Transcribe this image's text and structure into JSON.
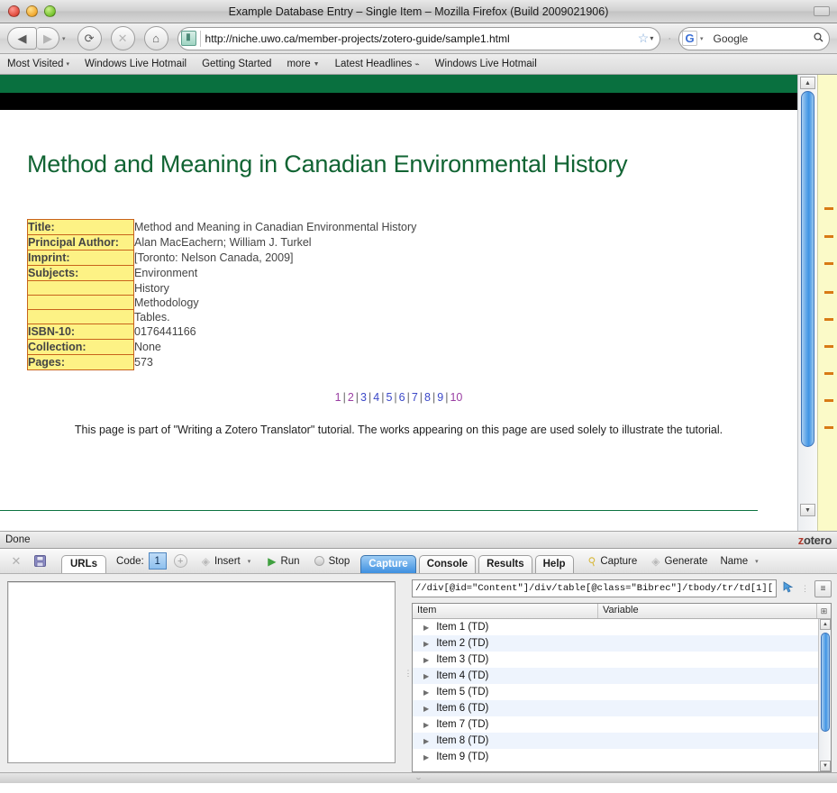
{
  "window": {
    "title": "Example Database Entry – Single Item – Mozilla Firefox (Build 2009021906)"
  },
  "nav": {
    "back_icon": "◀",
    "forward_icon": "▶",
    "history_caret": "▾",
    "reload_icon": "⟳",
    "stop_icon": "✕",
    "home_icon": "⌂",
    "favicon_glyph": "Ⅱ",
    "url": "http://niche.uwo.ca/member-projects/zotero-guide/sample1.html",
    "star_icon": "☆",
    "url_caret": "▾",
    "separator_dot": "·",
    "search_engine_glyph": "G",
    "search_engine_caret": "▾",
    "search_text": "Google",
    "search_placeholder": "Google",
    "search_icon": "🔍"
  },
  "bookmarks": [
    {
      "label": "Most Visited",
      "caret": "▾",
      "feed": ""
    },
    {
      "label": "Windows Live Hotmail",
      "caret": "",
      "feed": ""
    },
    {
      "label": "Getting Started",
      "caret": "",
      "feed": ""
    },
    {
      "label": "more",
      "caret": "▼",
      "feed": ""
    },
    {
      "label": "Latest Headlines",
      "caret": "",
      "feed": "⌁"
    },
    {
      "label": "Windows Live Hotmail",
      "caret": "",
      "feed": ""
    }
  ],
  "page": {
    "heading": "Method and Meaning in Canadian Environmental History",
    "bibrec": [
      {
        "label": "Title:",
        "value": "Method and Meaning in Canadian Environmental History"
      },
      {
        "label": "Principal Author:",
        "value": "Alan MacEachern; William J. Turkel"
      },
      {
        "label": "Imprint:",
        "value": "[Toronto: Nelson Canada, 2009]"
      },
      {
        "label": "Subjects:",
        "value": "Environment"
      },
      {
        "label": "",
        "value": "History"
      },
      {
        "label": "",
        "value": "Methodology"
      },
      {
        "label": "",
        "value": "Tables."
      },
      {
        "label": "ISBN-10:",
        "value": "0176441166"
      },
      {
        "label": "Collection:",
        "value": "None"
      },
      {
        "label": "Pages:",
        "value": "573"
      }
    ],
    "pager": [
      {
        "label": "1",
        "state": "visited"
      },
      {
        "label": "2",
        "state": "visited"
      },
      {
        "label": "3",
        "state": "unvisited"
      },
      {
        "label": "4",
        "state": "unvisited"
      },
      {
        "label": "5",
        "state": "unvisited"
      },
      {
        "label": "6",
        "state": "unvisited"
      },
      {
        "label": "7",
        "state": "unvisited"
      },
      {
        "label": "8",
        "state": "unvisited"
      },
      {
        "label": "9",
        "state": "unvisited"
      },
      {
        "label": "10",
        "state": "visited"
      }
    ],
    "pager_separator": "|",
    "footer_note": "This page is part of \"Writing a Zotero Translator\" tutorial. The works appearing on this page are used solely to illustrate the tutorial.",
    "scroll_up_icon": "▲",
    "scroll_down_icon": "▼"
  },
  "statusbar": {
    "status_text": "Done",
    "brand_z": "z",
    "brand_rest": "otero"
  },
  "devtools": {
    "close_icon": "✕",
    "save_icon": "💾",
    "urls_tab": "URLs",
    "code_label": "Code:",
    "code_value": "1",
    "add_icon": "+",
    "insert_label": "Insert",
    "insert_caret": "▾",
    "run_label": "Run",
    "run_icon": "▶",
    "stop_label": "Stop",
    "tabs": [
      {
        "label": "Capture",
        "active": true
      },
      {
        "label": "Console",
        "active": false
      },
      {
        "label": "Results",
        "active": false
      },
      {
        "label": "Help",
        "active": false
      }
    ],
    "capture_label": "Capture",
    "generate_label": "Generate",
    "name_label": "Name",
    "name_caret": "▾",
    "xpath_value": "//div[@id=\"Content\"]/div/table[@class=\"Bibrec\"]/tbody/tr/td[1][",
    "xpath_placeholder": "XPath expression",
    "xpath_pick_icon": "⬉",
    "xpath_options_icon": "≡",
    "columns": [
      "Item",
      "Variable"
    ],
    "column_picker_icon": "⊞",
    "rows": [
      {
        "item": "Item 1 (TD)",
        "variable": ""
      },
      {
        "item": "Item 2 (TD)",
        "variable": ""
      },
      {
        "item": "Item 3 (TD)",
        "variable": ""
      },
      {
        "item": "Item 4 (TD)",
        "variable": ""
      },
      {
        "item": "Item 5 (TD)",
        "variable": ""
      },
      {
        "item": "Item 6 (TD)",
        "variable": ""
      },
      {
        "item": "Item 7 (TD)",
        "variable": ""
      },
      {
        "item": "Item 8 (TD)",
        "variable": ""
      },
      {
        "item": "Item 9 (TD)",
        "variable": ""
      }
    ],
    "row_expand_icon": "▶",
    "scroll_up_icon": "▲",
    "scroll_down_icon": "▼",
    "code_editor_value": ""
  },
  "colors": {
    "page_heading": "#116433",
    "banner_green": "#09703f",
    "label_bg": "#fdf285",
    "label_border": "#c8631c",
    "link_visited": "#9a3fa3",
    "link_unvisited": "#3b48c8",
    "active_tab": "#3d8fe0",
    "find_mark": "#d87a15",
    "zotero_z": "#b03a2e"
  }
}
